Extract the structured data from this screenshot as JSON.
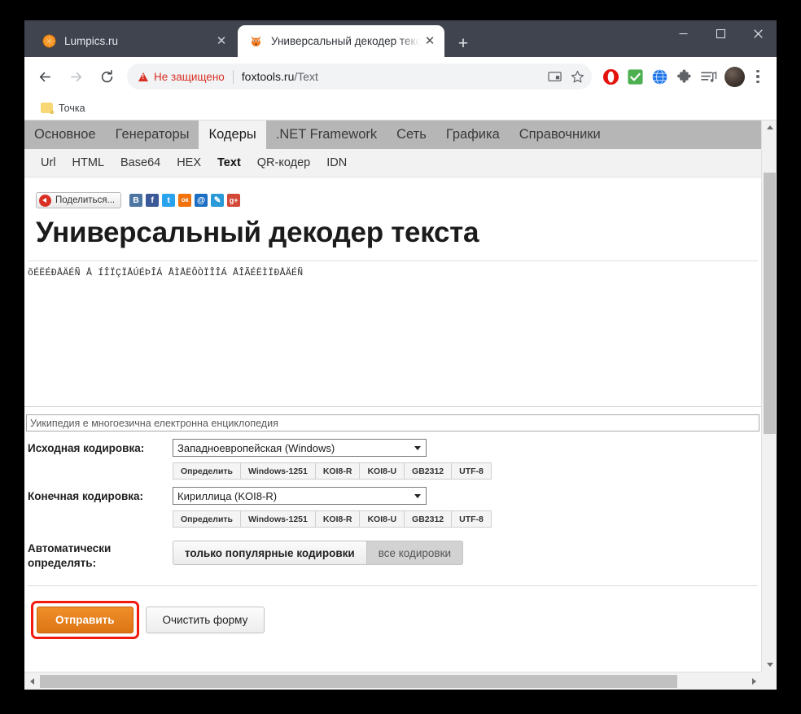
{
  "window": {
    "minimize_label": "—",
    "maximize_label": "☐",
    "close_label": "✕"
  },
  "tabs": [
    {
      "title": "Lumpics.ru",
      "favicon": "orange-circle-favicon",
      "close_label": "✕",
      "active": false
    },
    {
      "title": "Универсальный декодер текста",
      "favicon": "fox-favicon",
      "close_label": "✕",
      "active": true
    }
  ],
  "newtab_label": "+",
  "toolbar": {
    "back_label": "←",
    "forward_label": "→",
    "reload_label": "⟳",
    "security_text": "Не защищено",
    "url_host": "foxtools.ru",
    "url_path": "/Text",
    "cast_icon": "cast-icon",
    "bookmark_star": "☆",
    "extensions": [
      {
        "name": "opera-vpn-icon",
        "color": "#e3120b",
        "glyph": "✋"
      },
      {
        "name": "checkmark-extension-icon",
        "color": "#4caf50",
        "glyph": "✔"
      },
      {
        "name": "globe-extension-icon",
        "color": "#1a73e8",
        "glyph": "⊕"
      },
      {
        "name": "puzzle-extensions-icon",
        "color": "#5f6368",
        "glyph": "❖"
      },
      {
        "name": "media-playlist-icon",
        "color": "#5f6368",
        "glyph": "♫"
      }
    ],
    "profile_name": "avatar",
    "menu_name": "chrome-menu"
  },
  "bookmarks": [
    {
      "label": "Точка",
      "icon": "folder-icon"
    }
  ],
  "site": {
    "nav": [
      {
        "label": "Основное",
        "active": false
      },
      {
        "label": "Генераторы",
        "active": false
      },
      {
        "label": "Кодеры",
        "active": true
      },
      {
        "label": ".NET Framework",
        "active": false
      },
      {
        "label": "Сеть",
        "active": false
      },
      {
        "label": "Графика",
        "active": false
      },
      {
        "label": "Справочники",
        "active": false
      }
    ],
    "subnav": [
      {
        "label": "Url",
        "active": false
      },
      {
        "label": "HTML",
        "active": false
      },
      {
        "label": "Base64",
        "active": false
      },
      {
        "label": "HEX",
        "active": false
      },
      {
        "label": "Text",
        "active": true
      },
      {
        "label": "QR-кодер",
        "active": false
      },
      {
        "label": "IDN",
        "active": false
      }
    ],
    "share": {
      "button_label": "Поделиться...",
      "networks": [
        {
          "name": "vk-icon",
          "glyph": "B",
          "color": "#4c75a3"
        },
        {
          "name": "facebook-icon",
          "glyph": "f",
          "color": "#3b5998"
        },
        {
          "name": "twitter-icon",
          "glyph": "t",
          "color": "#2aa3ef"
        },
        {
          "name": "odnoklassniki-icon",
          "glyph": "ок",
          "color": "#f2720c"
        },
        {
          "name": "mailru-icon",
          "glyph": "@",
          "color": "#1b6ec2"
        },
        {
          "name": "livejournal-icon",
          "glyph": "✎",
          "color": "#2a9bd8"
        },
        {
          "name": "googleplus-icon",
          "glyph": "g+",
          "color": "#d34836"
        }
      ]
    },
    "page_title": "Универсальный декодер текста",
    "decoded_output": "õÉËÉÐÅÄÉÑ Å ÍÎÏÇÏÅÚÉÞÎÁ ÅÌÅËÔÒÏÎÎÁ ÅÎÃÉËÌÏÐÅÄÉÑ",
    "source_text": "Уикипедия е многоезична електронна енциклопедия",
    "form": {
      "source_encoding_label": "Исходная кодировка:",
      "source_encoding_value": "Западноевропейская (Windows)",
      "target_encoding_label": "Конечная кодировка:",
      "target_encoding_value": "Кириллица (KOI8-R)",
      "quick_buttons": [
        "Определить",
        "Windows-1251",
        "KOI8-R",
        "KOI8-U",
        "GB2312",
        "UTF-8"
      ],
      "auto_detect_label": "Автоматически определять:",
      "auto_popular_label": "только популярные кодировки",
      "auto_all_label": "все кодировки",
      "submit_label": "Отправить",
      "clear_label": "Очистить форму"
    }
  },
  "colors": {
    "tabstrip": "#40444f",
    "accent_orange": "#e07c16",
    "highlight_red": "#f01c0f",
    "nav_gray": "#b6b6b6"
  }
}
